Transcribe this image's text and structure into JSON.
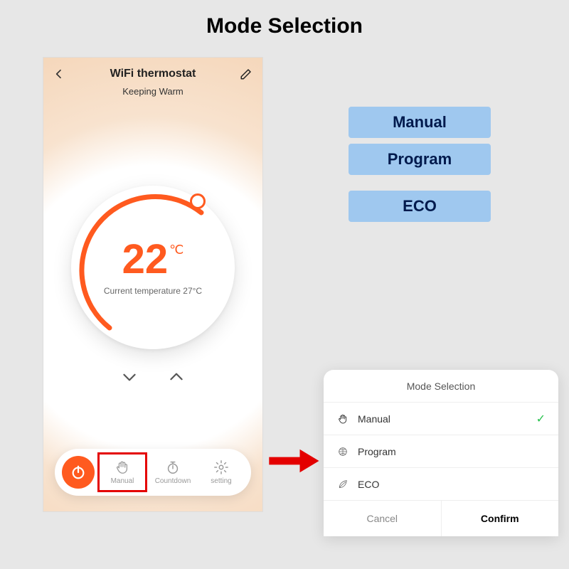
{
  "page": {
    "title": "Mode Selection"
  },
  "phone": {
    "title": "WiFi thermostat",
    "status": "Keeping Warm",
    "set_temp": "22",
    "unit": "℃",
    "current_line": "Current temperature 27°C"
  },
  "toolbar": {
    "manual": "Manual",
    "countdown": "Countdown",
    "setting": "setting"
  },
  "modes": {
    "manual": "Manual",
    "program": "Program",
    "eco": "ECO"
  },
  "popup": {
    "title": "Mode Selection",
    "manual": "Manual",
    "program": "Program",
    "eco": "ECO",
    "cancel": "Cancel",
    "confirm": "Confirm"
  }
}
